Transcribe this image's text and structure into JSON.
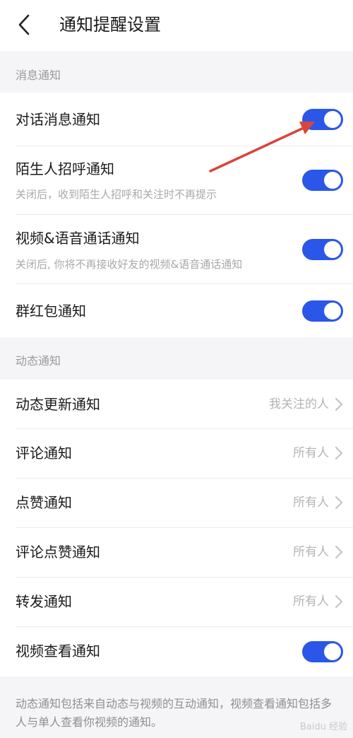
{
  "header": {
    "title": "通知提醒设置",
    "back_icon": "chevron-left-icon"
  },
  "sections": {
    "message": {
      "label": "消息通知",
      "rows": [
        {
          "title": "对话消息通知",
          "subtitle": "",
          "toggle_on": true
        },
        {
          "title": "陌生人招呼通知",
          "subtitle": "关闭后，收到陌生人招呼和关注时不再提示",
          "toggle_on": true
        },
        {
          "title": "视频&语音通话通知",
          "subtitle": "关闭后, 你将不再接收好友的视频&语音通话通知",
          "toggle_on": true
        },
        {
          "title": "群红包通知",
          "subtitle": "",
          "toggle_on": true
        }
      ]
    },
    "feed": {
      "label": "动态通知",
      "rows": [
        {
          "title": "动态更新通知",
          "value": "我关注的人"
        },
        {
          "title": "评论通知",
          "value": "所有人"
        },
        {
          "title": "点赞通知",
          "value": "所有人"
        },
        {
          "title": "评论点赞通知",
          "value": "所有人"
        },
        {
          "title": "转发通知",
          "value": "所有人"
        },
        {
          "title": "视频查看通知",
          "toggle_on": true
        }
      ]
    }
  },
  "footer_note": "动态通知包括来自动态与视频的互动通知，视频查看通知包括多人与单人查看你视频的通知。",
  "colors": {
    "accent": "#2a57e8",
    "annotation_arrow": "#d9443c"
  },
  "watermark": "Baidu 经验"
}
